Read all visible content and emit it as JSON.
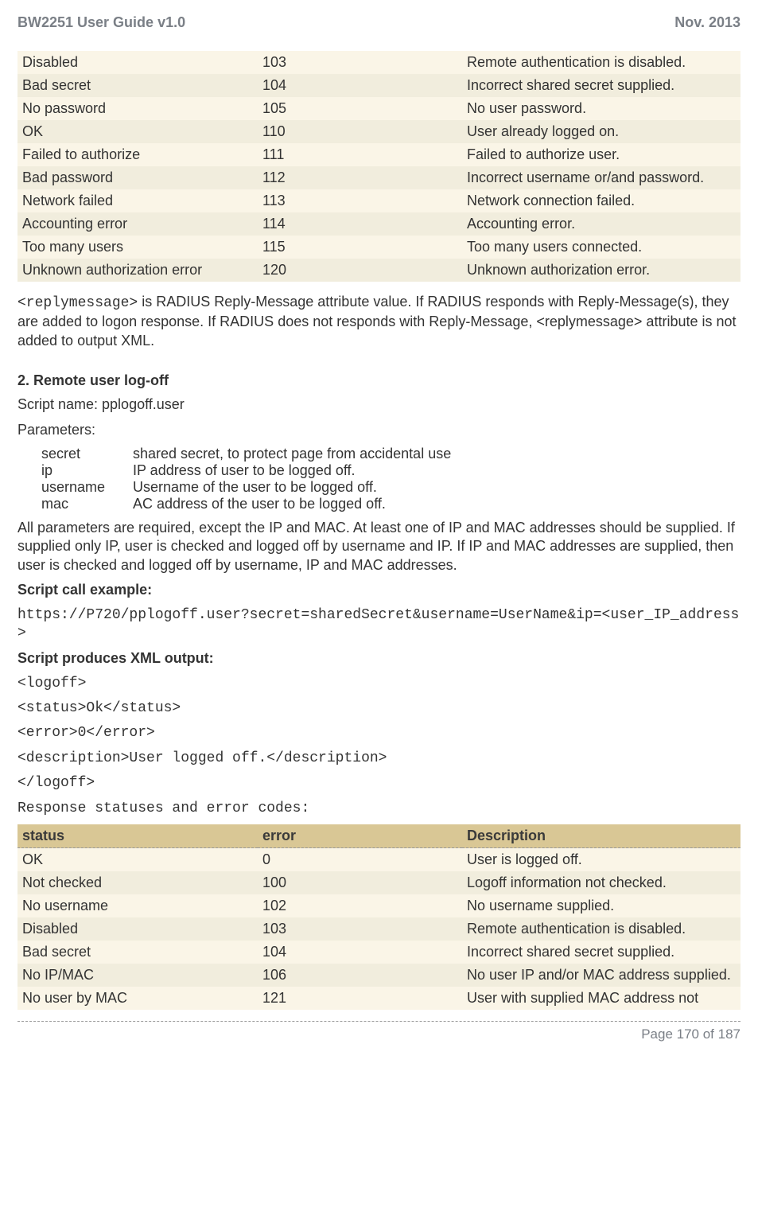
{
  "header": {
    "left": "BW2251 User Guide v1.0",
    "right": "Nov.  2013"
  },
  "table1": {
    "rows": [
      {
        "status": "Disabled",
        "error": "103",
        "desc": "Remote authentication is disabled."
      },
      {
        "status": "Bad secret",
        "error": "104",
        "desc": "Incorrect shared secret supplied."
      },
      {
        "status": "No password",
        "error": "105",
        "desc": "No user password."
      },
      {
        "status": "OK",
        "error": "110",
        "desc": "User already logged on."
      },
      {
        "status": "Failed to authorize",
        "error": "111",
        "desc": "Failed to authorize user."
      },
      {
        "status": "Bad password",
        "error": "112",
        "desc": "Incorrect username or/and password."
      },
      {
        "status": "Network failed",
        "error": "113",
        "desc": "Network connection failed."
      },
      {
        "status": "Accounting error",
        "error": "114",
        "desc": "Accounting error."
      },
      {
        "status": "Too many users",
        "error": "115",
        "desc": "Too many users connected."
      },
      {
        "status": "Unknown authorization error",
        "error": "120",
        "desc": "Unknown authorization error."
      }
    ]
  },
  "reply_tag": "<replymessage>",
  "reply_para": " is RADIUS Reply-Message attribute value. If RADIUS responds with Reply-Message(s), they are added to logon response. If RADIUS does not responds with Reply-Message, <replymessage> attribute is not added to output XML.",
  "section2_title": "2. Remote user log-off",
  "script_name_label": "Script name: pplogoff.user",
  "params_label": "Parameters:",
  "params": [
    {
      "n": "secret",
      "d": "shared secret, to protect page from accidental use"
    },
    {
      "n": "ip",
      "d": "IP address of user to be logged off."
    },
    {
      "n": "username",
      "d": "Username of the user to be logged off."
    },
    {
      "n": "mac",
      "d": "AC address of the user to be logged off."
    }
  ],
  "params_note": "All parameters are required, except the IP and MAC. At least one of IP and MAC addresses should be supplied. If supplied only IP, user is checked and logged off by username and IP. If IP and MAC addresses are supplied, then user is checked and logged off by username, IP and MAC addresses.",
  "script_call_label": "Script call example:",
  "script_call": "https://P720/pplogoff.user?secret=sharedSecret&username=UserName&ip=<user_IP_address>",
  "xml_label": "Script produces XML output:",
  "xml_lines": [
    "<logoff>",
    "<status>Ok</status>",
    "<error>0</error>",
    "<description>User logged off.</description>",
    "</logoff>"
  ],
  "resp_label": "Response statuses and error codes:",
  "table2": {
    "headers": {
      "c1": "status",
      "c2": "error",
      "c3": "Description"
    },
    "rows": [
      {
        "status": "OK",
        "error": "0",
        "desc": "User is logged off."
      },
      {
        "status": "Not checked",
        "error": "100",
        "desc": "Logoff information not checked."
      },
      {
        "status": "No username",
        "error": "102",
        "desc": "No username supplied."
      },
      {
        "status": "Disabled",
        "error": "103",
        "desc": "Remote authentication is disabled."
      },
      {
        "status": "Bad secret",
        "error": "104",
        "desc": "Incorrect shared secret supplied."
      },
      {
        "status": "No IP/MAC",
        "error": "106",
        "desc": "No user IP and/or MAC address supplied."
      },
      {
        "status": "No user by MAC",
        "error": "121",
        "desc": "User with supplied MAC address not"
      }
    ]
  },
  "footer": "Page 170 of 187"
}
